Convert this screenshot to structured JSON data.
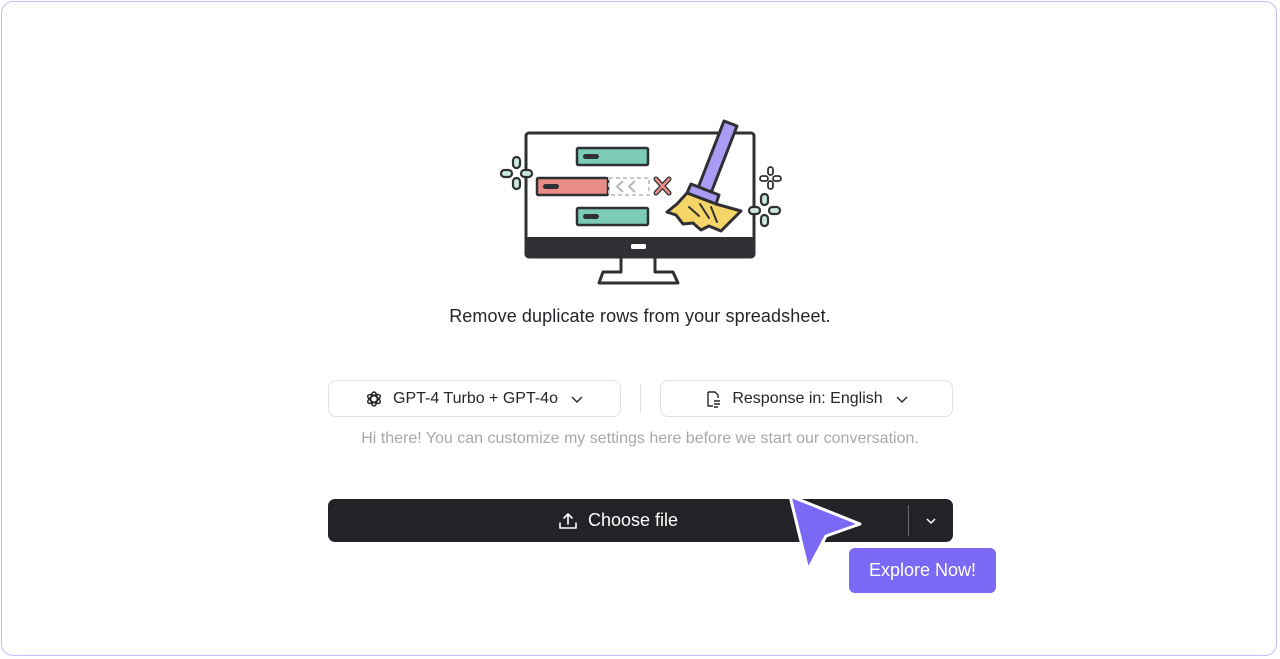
{
  "tagline": "Remove duplicate rows from your spreadsheet.",
  "settings": {
    "model_label": "GPT-4 Turbo + GPT-4o",
    "model_icon": "openai-icon",
    "language_label": "Response in: English",
    "language_icon": "language-doc-icon"
  },
  "hint": "Hi there! You can customize my settings here before we start our conversation.",
  "upload": {
    "label": "Choose file",
    "icon": "upload-icon"
  },
  "promo": {
    "label": "Explore Now!"
  },
  "colors": {
    "accent": "#7b68f4",
    "dark_button": "#222326",
    "border": "#c4bdf6"
  }
}
